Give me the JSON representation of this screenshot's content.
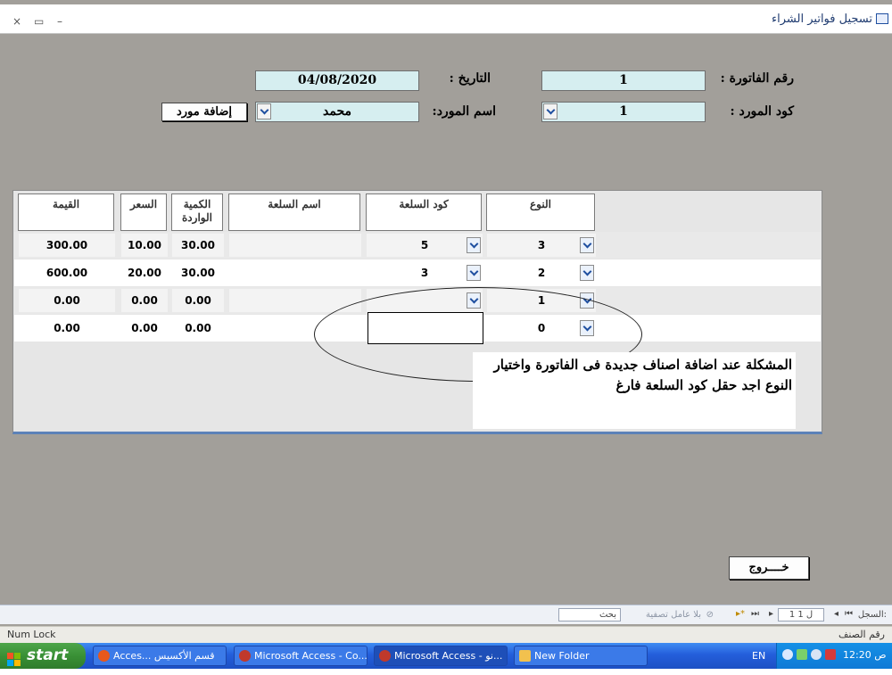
{
  "window": {
    "title": "تسجيل فواتير الشراء",
    "controls": [
      "×",
      "▭",
      "–"
    ]
  },
  "form": {
    "invoice_no_label": "رقم الفاتورة :",
    "invoice_no": "1",
    "date_label": "التاريخ :",
    "date": "04/08/2020",
    "supplier_code_label": "كود المورد :",
    "supplier_code": "1",
    "supplier_name_label": "اسم المورد:",
    "supplier_name": "محمد",
    "add_supplier_button": "إضافة مورد",
    "exit_button": "خــــروج"
  },
  "grid": {
    "headers": {
      "type": "النوع",
      "item_code": "كود السلعة",
      "item_name": "اسم السلعة",
      "qty": "الكمية الواردة",
      "price": "السعر",
      "value": "القيمة"
    },
    "rows": [
      {
        "type": "3",
        "code": "5",
        "name": "",
        "qty": "30.00",
        "price": "10.00",
        "value": "300.00"
      },
      {
        "type": "2",
        "code": "3",
        "name": "",
        "qty": "30.00",
        "price": "20.00",
        "value": "600.00"
      },
      {
        "type": "1",
        "code": "",
        "name": "",
        "qty": "0.00",
        "price": "0.00",
        "value": "0.00"
      },
      {
        "type": "0",
        "code": "",
        "name": "",
        "qty": "0.00",
        "price": "0.00",
        "value": "0.00"
      }
    ]
  },
  "annotation": {
    "text": "المشكلة عند اضافة اصناف جديدة فى الفاتورة واختيار النوع اجد حقل كود السلعة فارغ"
  },
  "navbar": {
    "record_label": "السجل:",
    "record_value": "1 ل 1",
    "filter_label": "بلا عامل تصفية",
    "search_label": "بحث"
  },
  "statusbar": {
    "left": "Num Lock",
    "right": "رقم الصنف"
  },
  "taskbar": {
    "start": "start",
    "tasks": [
      {
        "label": "Acces... قسم الأكسيس",
        "icon_color": "#e8581c"
      },
      {
        "label": "Microsoft Access - Co...",
        "icon_color": "#c0392b"
      },
      {
        "label": "Microsoft Access - نو...",
        "icon_color": "#c0392b"
      },
      {
        "label": "New Folder",
        "icon_color": "#f2c14e"
      }
    ],
    "lang": "EN",
    "clock": "ص 12:20"
  }
}
